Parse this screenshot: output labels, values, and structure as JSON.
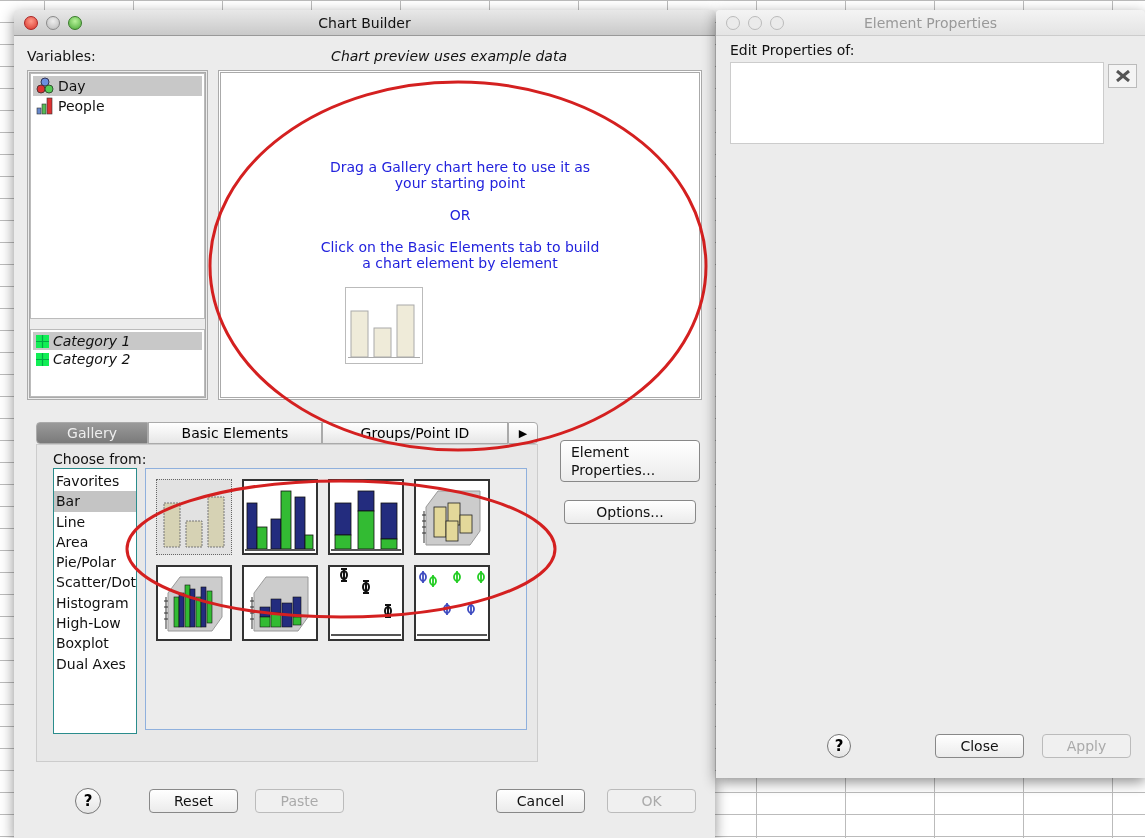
{
  "chart_builder": {
    "title": "Chart Builder",
    "active": true,
    "variables_label": "Variables:",
    "variables": [
      {
        "name": "Day",
        "kind": "nominal",
        "selected": true
      },
      {
        "name": "People",
        "kind": "scale",
        "selected": false
      }
    ],
    "categories": [
      {
        "name": "Category 1",
        "selected": true
      },
      {
        "name": "Category 2",
        "selected": false
      }
    ],
    "preview_caption": "Chart preview uses example data",
    "preview_messages": [
      "Drag a Gallery chart here to use it as\nyour starting point",
      "OR",
      "Click on the Basic Elements tab to build\na chart element by element"
    ],
    "tabs": [
      {
        "label": "Gallery",
        "selected": true
      },
      {
        "label": "Basic Elements",
        "selected": false
      },
      {
        "label": "Groups/Point ID",
        "selected": false
      }
    ],
    "tab_scroll": "▶",
    "choose_from": "Choose from:",
    "chart_types": [
      {
        "label": "Favorites",
        "selected": false
      },
      {
        "label": "Bar",
        "selected": true
      },
      {
        "label": "Line",
        "selected": false
      },
      {
        "label": "Area",
        "selected": false
      },
      {
        "label": "Pie/Polar",
        "selected": false
      },
      {
        "label": "Scatter/Dot",
        "selected": false
      },
      {
        "label": "Histogram",
        "selected": false
      },
      {
        "label": "High-Low",
        "selected": false
      },
      {
        "label": "Boxplot",
        "selected": false
      },
      {
        "label": "Dual Axes",
        "selected": false
      }
    ],
    "thumbnails": [
      {
        "kind": "simple-bar",
        "selected": true
      },
      {
        "kind": "clustered-bar",
        "selected": false
      },
      {
        "kind": "stacked-bar",
        "selected": false
      },
      {
        "kind": "bar3d",
        "selected": false
      },
      {
        "kind": "clustered3d",
        "selected": false
      },
      {
        "kind": "stacked3d",
        "selected": false
      },
      {
        "kind": "error-bar",
        "selected": false
      },
      {
        "kind": "clustered-error-bar",
        "selected": false
      }
    ],
    "side_buttons": [
      {
        "label": "Element\nProperties..."
      },
      {
        "label": "Options..."
      }
    ],
    "help": "?",
    "buttons": [
      {
        "label": "Reset",
        "disabled": false
      },
      {
        "label": "Paste",
        "disabled": true
      },
      {
        "label": "Cancel",
        "disabled": false
      },
      {
        "label": "OK",
        "disabled": true
      }
    ]
  },
  "element_properties": {
    "title": "Element Properties",
    "active": false,
    "edit_label": "Edit Properties of:",
    "help": "?",
    "buttons": [
      {
        "label": "Close",
        "disabled": false
      },
      {
        "label": "Apply",
        "disabled": true
      }
    ]
  }
}
